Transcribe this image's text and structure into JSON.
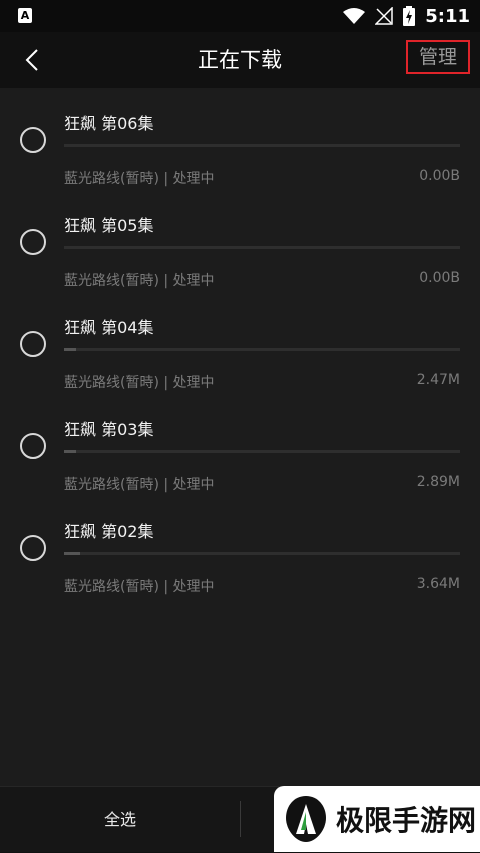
{
  "status_bar": {
    "app_icon_letter": "A",
    "time": "5:11"
  },
  "header": {
    "title": "正在下载",
    "manage_label": "管理"
  },
  "downloads": [
    {
      "title": "狂飙 第06集",
      "meta": "藍光路线(暂時) | 处理中",
      "size": "0.00B",
      "progress": 0.0
    },
    {
      "title": "狂飙 第05集",
      "meta": "藍光路线(暂時) | 处理中",
      "size": "0.00B",
      "progress": 0.0
    },
    {
      "title": "狂飙 第04集",
      "meta": "藍光路线(暂時) | 处理中",
      "size": "2.47M",
      "progress": 0.03
    },
    {
      "title": "狂飙 第03集",
      "meta": "藍光路线(暂時) | 处理中",
      "size": "2.89M",
      "progress": 0.03
    },
    {
      "title": "狂飙 第02集",
      "meta": "藍光路线(暂時) | 处理中",
      "size": "3.64M",
      "progress": 0.04
    }
  ],
  "bottom_bar": {
    "select_all_label": "全选"
  },
  "watermark": {
    "text": "极限手游网"
  },
  "colors": {
    "accent_red": "#e0242a",
    "background": "#1c1c1c"
  }
}
